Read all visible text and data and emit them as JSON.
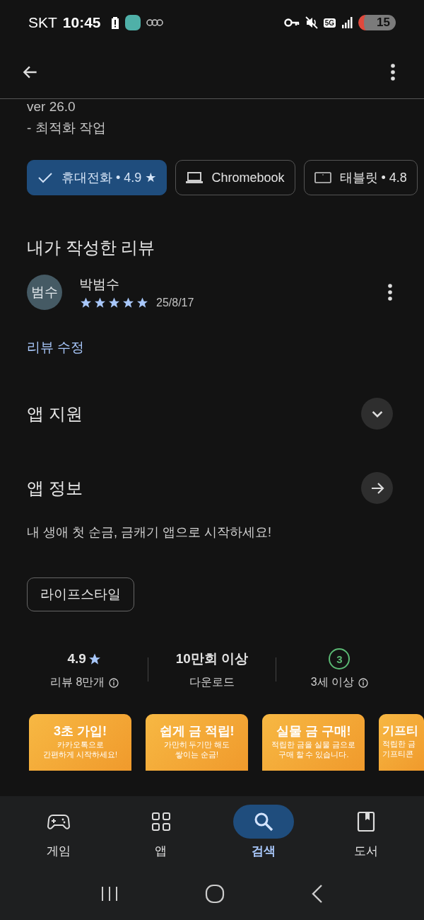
{
  "status_bar": {
    "carrier": "SKT",
    "time": "10:45",
    "network": "5G",
    "battery": "15"
  },
  "release_notes": [
    "ver 26.0",
    "- 최적화 작업"
  ],
  "device_chips": [
    {
      "kind": "phone",
      "label": "휴대전화 • 4.9 ★",
      "selected": true
    },
    {
      "kind": "laptop",
      "label": "Chromebook",
      "selected": false
    },
    {
      "kind": "tablet",
      "label": "태블릿 • 4.8",
      "selected": false
    }
  ],
  "my_review": {
    "heading": "내가 작성한 리뷰",
    "avatar": "범수",
    "author": "박범수",
    "stars": 5,
    "date": "25/8/17",
    "edit_link": "리뷰 수정"
  },
  "sections": [
    {
      "kind": "expand",
      "title": "앱 지원"
    },
    {
      "kind": "arrow",
      "title": "앱 정보"
    }
  ],
  "description": "내 생애 첫 순금, 금캐기 앱으로 시작하세요!",
  "category_tag": "라이프스타일",
  "stats": [
    {
      "kind": "rating",
      "value": "4.9",
      "label": "리뷰 8만개"
    },
    {
      "kind": "plain",
      "value": "10만회 이상",
      "label": "다운로드"
    },
    {
      "kind": "age",
      "value": "3",
      "label": "3세 이상"
    }
  ],
  "screenshots": [
    {
      "title": "3초 가입!",
      "lines": [
        "카카오톡으로",
        "간편하게 시작하세요!"
      ]
    },
    {
      "title": "쉽게 금 적립!",
      "lines": [
        "가만히 두기만 해도",
        "쌓이는 순금!"
      ]
    },
    {
      "title": "실물 금 구매!",
      "lines": [
        "적립한 금을 실물 금으로",
        "구매 할 수 있습니다."
      ]
    },
    {
      "title": "기프티",
      "lines": [
        "적립한 금",
        "기프티콘"
      ]
    }
  ],
  "bottom_nav": [
    {
      "kind": "games",
      "label": "게임",
      "selected": false
    },
    {
      "kind": "apps",
      "label": "앱",
      "selected": false
    },
    {
      "kind": "search",
      "label": "검색",
      "selected": true
    },
    {
      "kind": "books",
      "label": "도서",
      "selected": false
    }
  ]
}
